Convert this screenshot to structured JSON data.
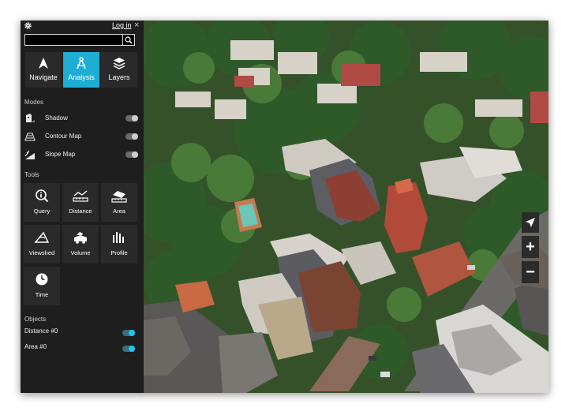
{
  "panel": {
    "login_label": "Log in",
    "close_label": "×",
    "search": {
      "value": "",
      "placeholder": ""
    },
    "tabs": [
      {
        "label": "Navigate",
        "icon": "navigate-arrow-icon",
        "active": false
      },
      {
        "label": "Analysis",
        "icon": "compass-icon",
        "active": true
      },
      {
        "label": "Layers",
        "icon": "layers-icon",
        "active": false
      }
    ],
    "modes_title": "Modes",
    "modes": [
      {
        "label": "Shadow",
        "icon": "shadow-icon",
        "on": false
      },
      {
        "label": "Contour Map",
        "icon": "contour-map-icon",
        "on": false
      },
      {
        "label": "Slope Map",
        "icon": "slope-map-icon",
        "on": false
      }
    ],
    "tools_title": "Tools",
    "tools": [
      {
        "label": "Query",
        "icon": "query-icon"
      },
      {
        "label": "Distance",
        "icon": "distance-icon"
      },
      {
        "label": "Area",
        "icon": "area-icon"
      },
      {
        "label": "Viewshed",
        "icon": "viewshed-icon"
      },
      {
        "label": "Volume",
        "icon": "volume-icon"
      },
      {
        "label": "Profile",
        "icon": "profile-icon"
      },
      {
        "label": "Time",
        "icon": "time-icon"
      }
    ],
    "objects_title": "Objects",
    "objects": [
      {
        "label": "Distance #0",
        "on": true
      },
      {
        "label": "Area #0",
        "on": true
      }
    ]
  },
  "map_controls": [
    {
      "label": "",
      "icon": "pointer-arrow-icon"
    },
    {
      "label": "+",
      "icon": "zoom-in-icon"
    },
    {
      "label": "−",
      "icon": "zoom-out-icon"
    }
  ],
  "colors": {
    "accent": "#1eaed3",
    "panel_bg": "#1e1e1e",
    "tile_bg": "#2a2a2a",
    "toggle_on": "#1ec7ec"
  }
}
